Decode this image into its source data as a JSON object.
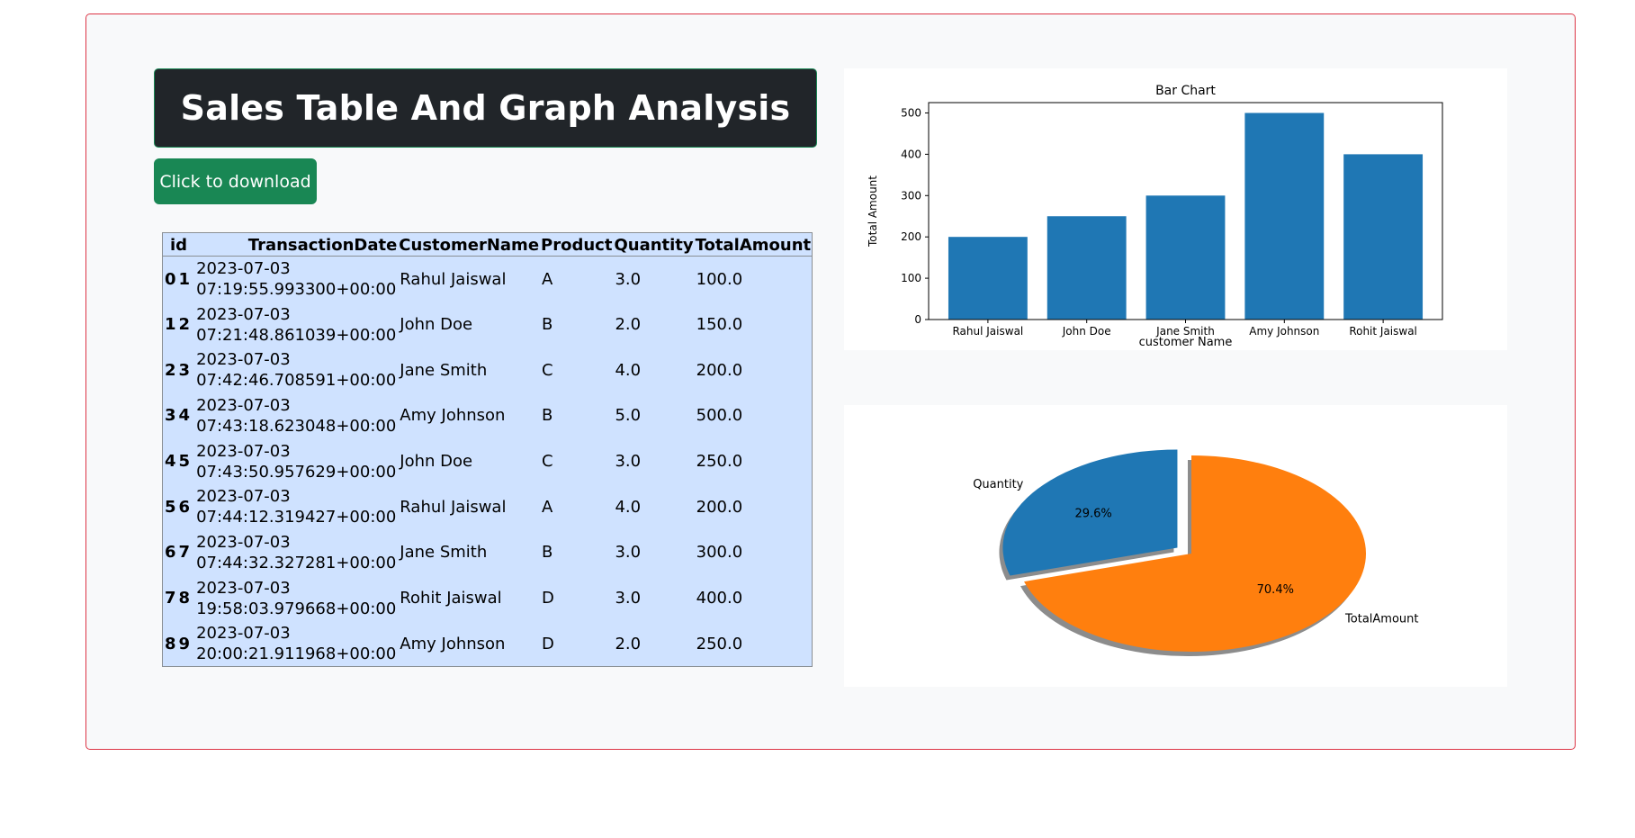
{
  "page": {
    "title": "Sales Table And Graph Analysis",
    "download_label": "Click to download"
  },
  "table": {
    "headers": [
      "id",
      "TransactionDate",
      "CustomerName",
      "Product",
      "Quantity",
      "TotalAmount"
    ],
    "rows": [
      {
        "index": "0",
        "id": "1",
        "date": "2023-07-03",
        "time": "07:19:55.993300+00:00",
        "customer": "Rahul Jaiswal",
        "product": "A",
        "quantity": "3.0",
        "total": "100.0"
      },
      {
        "index": "1",
        "id": "2",
        "date": "2023-07-03",
        "time": "07:21:48.861039+00:00",
        "customer": "John Doe",
        "product": "B",
        "quantity": "2.0",
        "total": "150.0"
      },
      {
        "index": "2",
        "id": "3",
        "date": "2023-07-03",
        "time": "07:42:46.708591+00:00",
        "customer": "Jane Smith",
        "product": "C",
        "quantity": "4.0",
        "total": "200.0"
      },
      {
        "index": "3",
        "id": "4",
        "date": "2023-07-03",
        "time": "07:43:18.623048+00:00",
        "customer": "Amy Johnson",
        "product": "B",
        "quantity": "5.0",
        "total": "500.0"
      },
      {
        "index": "4",
        "id": "5",
        "date": "2023-07-03",
        "time": "07:43:50.957629+00:00",
        "customer": "John Doe",
        "product": "C",
        "quantity": "3.0",
        "total": "250.0"
      },
      {
        "index": "5",
        "id": "6",
        "date": "2023-07-03",
        "time": "07:44:12.319427+00:00",
        "customer": "Rahul Jaiswal",
        "product": "A",
        "quantity": "4.0",
        "total": "200.0"
      },
      {
        "index": "6",
        "id": "7",
        "date": "2023-07-03",
        "time": "07:44:32.327281+00:00",
        "customer": "Jane Smith",
        "product": "B",
        "quantity": "3.0",
        "total": "300.0"
      },
      {
        "index": "7",
        "id": "8",
        "date": "2023-07-03",
        "time": "19:58:03.979668+00:00",
        "customer": "Rohit Jaiswal",
        "product": "D",
        "quantity": "3.0",
        "total": "400.0"
      },
      {
        "index": "8",
        "id": "9",
        "date": "2023-07-03",
        "time": "20:00:21.911968+00:00",
        "customer": "Amy Johnson",
        "product": "D",
        "quantity": "2.0",
        "total": "250.0"
      }
    ]
  },
  "chart_data": [
    {
      "type": "bar",
      "title": "Bar Chart",
      "xlabel": "customer Name",
      "ylabel": "Total Amount",
      "categories": [
        "Rahul Jaiswal",
        "John Doe",
        "Jane Smith",
        "Amy Johnson",
        "Rohit Jaiswal"
      ],
      "values": [
        200,
        250,
        300,
        500,
        400
      ],
      "yticks": [
        0,
        100,
        200,
        300,
        400,
        500
      ],
      "ylim": [
        0,
        525
      ],
      "color": "#1f77b4"
    },
    {
      "type": "pie",
      "labels": [
        "Quantity",
        "TotalAmount"
      ],
      "values": [
        29.6,
        70.4
      ],
      "value_labels": [
        "29.6%",
        "70.4%"
      ],
      "colors": [
        "#1f77b4",
        "#ff7f0e"
      ],
      "exploded": [
        "Quantity"
      ],
      "shadow": true
    }
  ]
}
